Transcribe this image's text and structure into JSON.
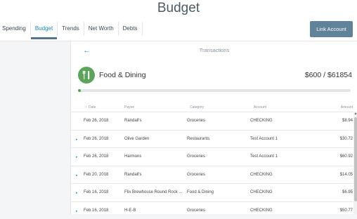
{
  "header": {
    "title": "Budget"
  },
  "tabs": [
    {
      "label": "Spending"
    },
    {
      "label": "Budget"
    },
    {
      "label": "Trends"
    },
    {
      "label": "Net Worth"
    },
    {
      "label": "Debts"
    }
  ],
  "link_button": {
    "label": "Link Account"
  },
  "panel": {
    "back_icon": "back-arrow-icon",
    "title": "Transactions"
  },
  "category": {
    "icon": "fork-knife-icon",
    "name": "Food & Dining",
    "amount": "$600 / $61854",
    "progress_fraction": 0.0097
  },
  "table": {
    "headers": {
      "date": "Date",
      "sort_icon": "sort-arrow-icon",
      "payee": "Payee",
      "category": "Category",
      "account": "Account",
      "amount": "Amount"
    },
    "rows": [
      {
        "date": "Feb 26, 2018",
        "payee": "Randall's",
        "category": "Groceries",
        "account": "CHECKING",
        "amount": "$8.94"
      },
      {
        "date": "Feb 26, 2018",
        "payee": "Olive Garden",
        "category": "Restaurants",
        "account": "Test Account 1",
        "amount": "$30.72"
      },
      {
        "date": "Feb 26, 2018",
        "payee": "Harmons",
        "category": "Groceries",
        "account": "Test Account 1",
        "amount": "$60.92"
      },
      {
        "date": "Feb 20, 2018",
        "payee": "Randall's",
        "category": "Groceries",
        "account": "CHECKING",
        "amount": "$14.05"
      },
      {
        "date": "Feb 16, 2018",
        "payee": "Flix Brewhouse Round Rock ...",
        "category": "Food & Dining",
        "account": "CHECKING",
        "amount": "$6.95"
      },
      {
        "date": "Feb 16, 2018",
        "payee": "H-E-B",
        "category": "Groceries",
        "account": "CHECKING",
        "amount": "$50.77"
      }
    ]
  },
  "colors": {
    "accent": "#1b86b4",
    "button": "#5f8399",
    "progress": "#4aa84a",
    "category_icon": "#5ba55b"
  }
}
